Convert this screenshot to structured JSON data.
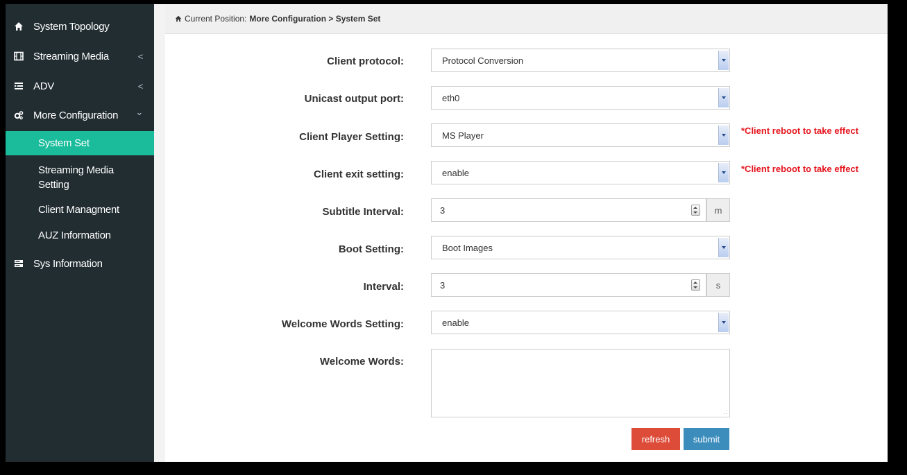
{
  "sidebar": {
    "items": [
      {
        "label": "System Topology",
        "icon": "home-icon"
      },
      {
        "label": "Streaming Media",
        "icon": "film-icon",
        "arrow": "<"
      },
      {
        "label": "ADV",
        "icon": "list-indent-icon",
        "arrow": "<"
      },
      {
        "label": "More Configuration",
        "icon": "cogs-icon",
        "arrow": "⌄"
      },
      {
        "label": "Sys Information",
        "icon": "server-icon"
      }
    ],
    "sub_items": [
      {
        "label": "System Set",
        "active": true
      },
      {
        "label": "Streaming Media Setting"
      },
      {
        "label": "Client Managment"
      },
      {
        "label": "AUZ Information"
      }
    ]
  },
  "breadcrumb": {
    "prefix": "Current Position:",
    "path": "More Configuration > System Set"
  },
  "form": {
    "client_protocol": {
      "label": "Client protocol:",
      "value": "Protocol Conversion"
    },
    "unicast_output_port": {
      "label": "Unicast output port:",
      "value": "eth0"
    },
    "client_player_setting": {
      "label": "Client Player Setting:",
      "value": "MS Player",
      "note": "*Client reboot to take effect"
    },
    "client_exit_setting": {
      "label": "Client exit setting:",
      "value": "enable",
      "note": "*Client reboot to take effect"
    },
    "subtitle_interval": {
      "label": "Subtitle Interval:",
      "value": "3",
      "unit": "m"
    },
    "boot_setting": {
      "label": "Boot Setting:",
      "value": "Boot Images"
    },
    "interval": {
      "label": "Interval:",
      "value": "3",
      "unit": "s"
    },
    "welcome_words_setting": {
      "label": "Welcome Words Setting:",
      "value": "enable"
    },
    "welcome_words": {
      "label": "Welcome Words:",
      "value": ""
    }
  },
  "buttons": {
    "refresh": "refresh",
    "submit": "submit"
  },
  "colors": {
    "sidebar_bg": "#222d32",
    "active_item": "#1abc9c",
    "note": "#e5141c",
    "refresh": "#dd4b39",
    "submit": "#3c8dbc"
  }
}
